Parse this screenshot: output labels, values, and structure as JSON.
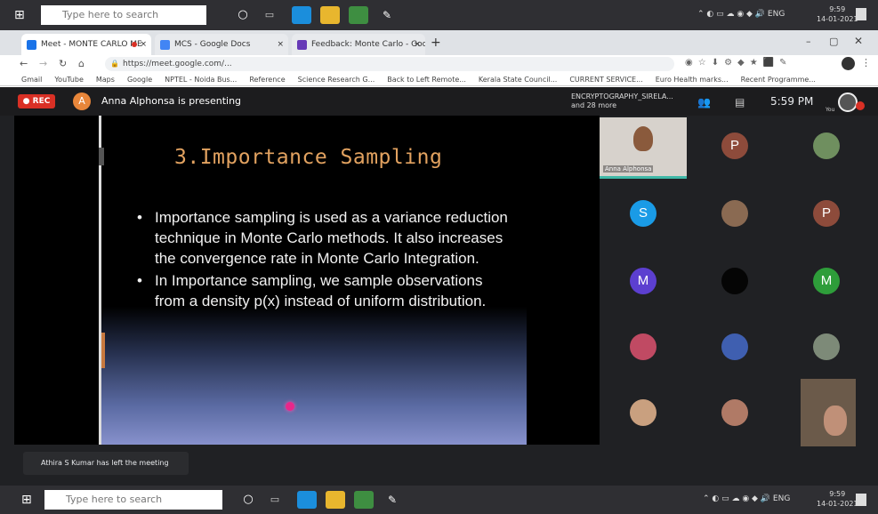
{
  "taskbar": {
    "search_placeholder": "Type here to search",
    "clock_time": "9:59",
    "clock_date": "14-01-2021"
  },
  "browser": {
    "tabs": [
      {
        "label": "Meet - MONTE CARLO ME",
        "favicon_color": "#1a73e8"
      },
      {
        "label": "MCS - Google Docs",
        "favicon_color": "#4285f4"
      },
      {
        "label": "Feedback: Monte Carlo - Google",
        "favicon_color": "#673ab7"
      }
    ],
    "url": "https://meet.google.com/...",
    "bookmarks": [
      "Gmail",
      "YouTube",
      "Maps",
      "Google",
      "NPTEL - Noida Bus...",
      "Reference",
      "Science Research G...",
      "Back to Left Remote...",
      "Kerala State Council...",
      "CURRENT SERVICE...",
      "Euro Health marks...",
      "Recent Programme..."
    ]
  },
  "meet": {
    "rec_label": "REC",
    "presenter_initial": "A",
    "presenting_text": "Anna Alphonsa is presenting",
    "participants_label": "ENCRYPTOGRAPHY_SIRELA...",
    "participants_more": "and 28 more",
    "time": "5:59 PM",
    "self_label": "You",
    "notice": "Athira S Kumar has left the meeting"
  },
  "slide": {
    "title": "3.Importance Sampling",
    "bullets": [
      "Importance sampling is used as a variance reduction technique in Monte Carlo methods. It also increases the convergence rate in Monte Carlo Integration.",
      "In Importance sampling, we sample observations from a density p(x) instead of uniform distribution."
    ],
    "bullet_glyph": "•"
  },
  "tiles": [
    {
      "name": "Anna Alphonsa",
      "initial": "",
      "color": "#b08870",
      "kind": "video"
    },
    {
      "name": "",
      "initial": "P",
      "color": "#8d4b3b",
      "kind": "avatar"
    },
    {
      "name": "",
      "initial": "",
      "color": "#6f8f5f",
      "kind": "photo"
    },
    {
      "name": "",
      "initial": "S",
      "color": "#1a9be6",
      "kind": "avatar"
    },
    {
      "name": "",
      "initial": "",
      "color": "#8a6a52",
      "kind": "photo"
    },
    {
      "name": "",
      "initial": "P",
      "color": "#8d4b3b",
      "kind": "avatar"
    },
    {
      "name": "",
      "initial": "M",
      "color": "#5c3fd0",
      "kind": "avatar"
    },
    {
      "name": "",
      "initial": "",
      "color": "#050505",
      "kind": "photo"
    },
    {
      "name": "",
      "initial": "M",
      "color": "#2e9d3a",
      "kind": "avatar"
    },
    {
      "name": "",
      "initial": "",
      "color": "#c04a63",
      "kind": "photo"
    },
    {
      "name": "",
      "initial": "",
      "color": "#3f5fb0",
      "kind": "photo"
    },
    {
      "name": "",
      "initial": "",
      "color": "#7d8a78",
      "kind": "photo"
    },
    {
      "name": "",
      "initial": "",
      "color": "#c9a07f",
      "kind": "photo"
    },
    {
      "name": "",
      "initial": "",
      "color": "#b07a66",
      "kind": "photo"
    },
    {
      "name": "",
      "initial": "",
      "color": "#6b5a4a",
      "kind": "video"
    }
  ]
}
